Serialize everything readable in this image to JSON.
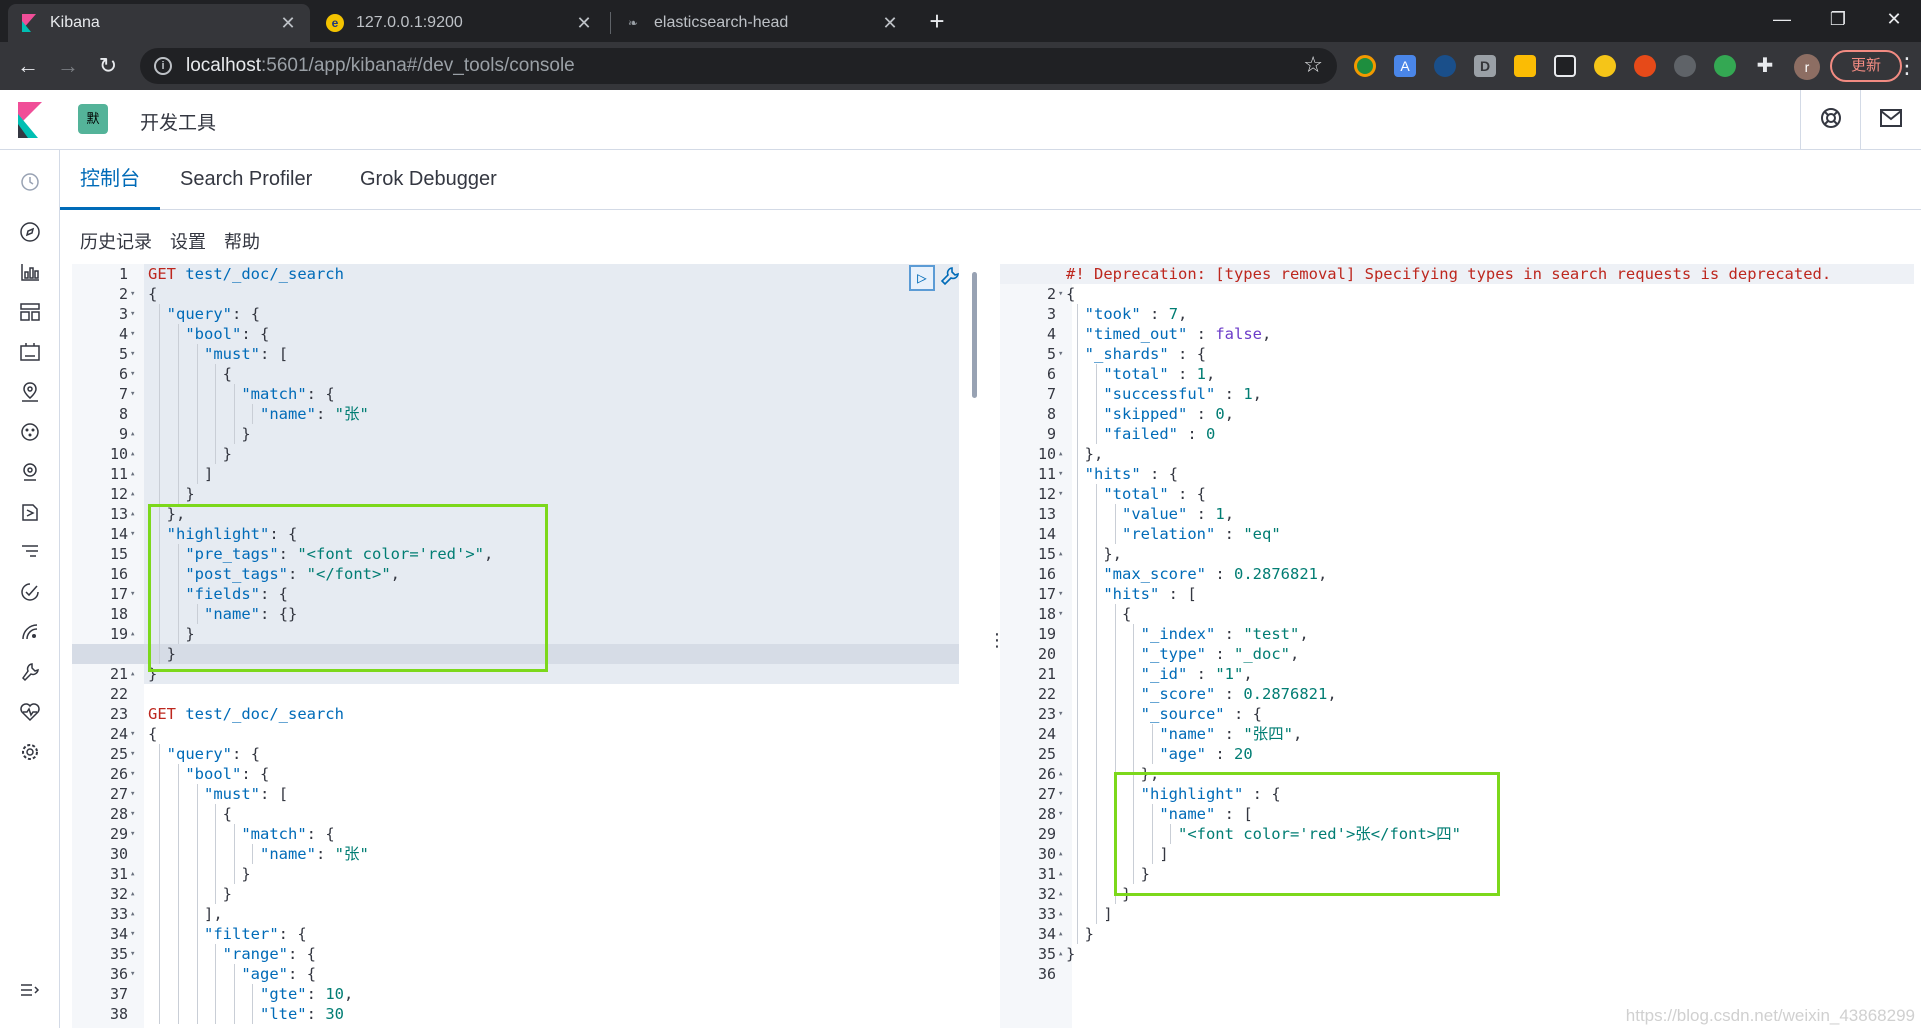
{
  "browser": {
    "tabs": [
      {
        "title": "Kibana",
        "active": true
      },
      {
        "title": "127.0.0.1:9200",
        "active": false
      },
      {
        "title": "elasticsearch-head",
        "active": false
      }
    ],
    "url_host": "localhost",
    "url_path": ":5601/app/kibana#/dev_tools/console",
    "profile_initial": "r",
    "update_label": "更新"
  },
  "kibana": {
    "space_avatar": "默",
    "breadcrumb": "开发工具",
    "tabs": [
      "控制台",
      "Search Profiler",
      "Grok Debugger"
    ],
    "menu": [
      "历史记录",
      "设置",
      "帮助"
    ]
  },
  "request_lines": [
    "GET test/_doc/_search",
    "{",
    "  \"query\": {",
    "    \"bool\": {",
    "      \"must\": [",
    "        {",
    "          \"match\": {",
    "            \"name\": \"张\"",
    "          }",
    "        }",
    "      ]",
    "    }",
    "  },",
    "  \"highlight\": {",
    "    \"pre_tags\": \"<font color='red'>\",",
    "    \"post_tags\": \"</font>\",",
    "    \"fields\": {",
    "      \"name\": {}",
    "    }",
    "  }",
    "}",
    "",
    "GET test/_doc/_search",
    "{",
    "  \"query\": {",
    "    \"bool\": {",
    "      \"must\": [",
    "        {",
    "          \"match\": {",
    "            \"name\": \"张\"",
    "          }",
    "        }",
    "      ],",
    "      \"filter\": {",
    "        \"range\": {",
    "          \"age\": {",
    "            \"gte\": 10,",
    "            \"lte\": 30"
  ],
  "request_folds": [
    "",
    "v",
    "v",
    "v",
    "v",
    "v",
    "v",
    "",
    "^",
    "^",
    "^",
    "^",
    "^",
    "v",
    "",
    "",
    "v",
    "",
    "^",
    "^",
    "^",
    "",
    "",
    "v",
    "v",
    "v",
    "v",
    "v",
    "v",
    "",
    "^",
    "^",
    "^",
    "v",
    "v",
    "v",
    "",
    ""
  ],
  "response_lines": [
    "#! Deprecation: [types removal] Specifying types in search requests is deprecated.",
    "{",
    "  \"took\" : 7,",
    "  \"timed_out\" : false,",
    "  \"_shards\" : {",
    "    \"total\" : 1,",
    "    \"successful\" : 1,",
    "    \"skipped\" : 0,",
    "    \"failed\" : 0",
    "  },",
    "  \"hits\" : {",
    "    \"total\" : {",
    "      \"value\" : 1,",
    "      \"relation\" : \"eq\"",
    "    },",
    "    \"max_score\" : 0.2876821,",
    "    \"hits\" : [",
    "      {",
    "        \"_index\" : \"test\",",
    "        \"_type\" : \"_doc\",",
    "        \"_id\" : \"1\",",
    "        \"_score\" : 0.2876821,",
    "        \"_source\" : {",
    "          \"name\" : \"张四\",",
    "          \"age\" : 20",
    "        },",
    "        \"highlight\" : {",
    "          \"name\" : [",
    "            \"<font color='red'>张</font>四\"",
    "          ]",
    "        }",
    "      }",
    "    ]",
    "  }",
    "}",
    ""
  ],
  "response_folds": [
    "",
    "v",
    "",
    "",
    "v",
    "",
    "",
    "",
    "",
    "^",
    "v",
    "v",
    "",
    "",
    "^",
    "",
    "v",
    "v",
    "",
    "",
    "",
    "",
    "v",
    "",
    "",
    "^",
    "v",
    "v",
    "",
    "^",
    "^",
    "^",
    "^",
    "^",
    "^",
    ""
  ],
  "watermark": "https://blog.csdn.net/weixin_43868299"
}
